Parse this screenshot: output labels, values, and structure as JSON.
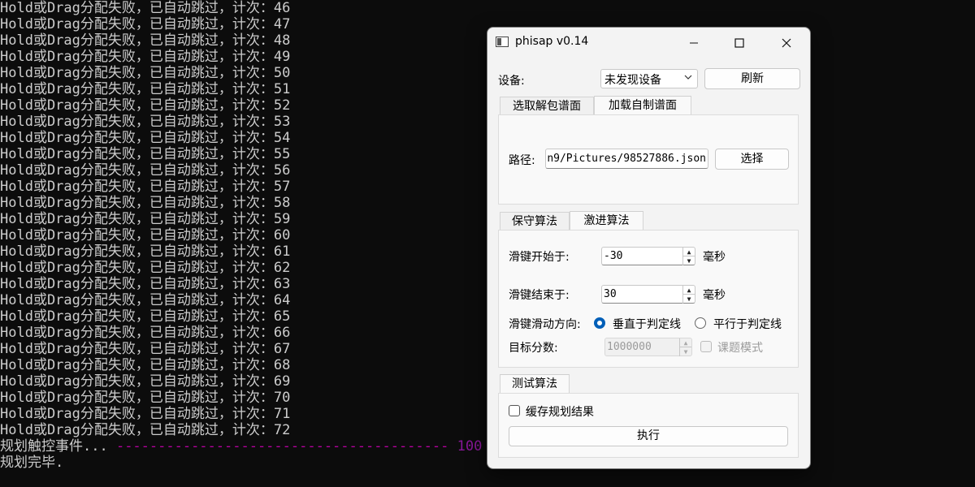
{
  "console": {
    "fail_prefix": "Hold或Drag分配失败，已自动跳过，计次：",
    "fail_counts": [
      46,
      47,
      48,
      49,
      50,
      51,
      52,
      53,
      54,
      55,
      56,
      57,
      58,
      59,
      60,
      61,
      62,
      63,
      64,
      65,
      66,
      67,
      68,
      69,
      70,
      71,
      72
    ],
    "planning_label": "规划触控事件... ",
    "planning_progress_bar": "----------------------------------------",
    "planning_percent": "100",
    "done_label": "规划完毕."
  },
  "window": {
    "title": "phisap v0.14",
    "minimize": "—",
    "maximize": "☐",
    "close": "✕"
  },
  "device": {
    "label": "设备:",
    "selected": "未发现设备",
    "refresh": "刷新"
  },
  "chart_source_tabs": [
    "选取解包谱面",
    "加载自制谱面"
  ],
  "chart_source": {
    "path_label": "路径:",
    "path_value": "n9/Pictures/98527886.json",
    "browse": "选择"
  },
  "algorithm_tabs": [
    "保守算法",
    "激进算法"
  ],
  "algorithm": {
    "slide_start_label": "滑键开始于:",
    "slide_start_value": "-30",
    "slide_start_unit": "毫秒",
    "slide_end_label": "滑键结束于:",
    "slide_end_value": "30",
    "slide_end_unit": "毫秒",
    "direction_label": "滑键滑动方向:",
    "direction_perpendicular": "垂直于判定线",
    "direction_parallel": "平行于判定线",
    "target_score_label": "目标分数:",
    "target_score_value": "1000000",
    "homework_mode": "课题模式"
  },
  "test_tab": "测试算法",
  "test": {
    "cache_label": "缓存规划结果",
    "execute": "执行"
  },
  "colors": {
    "console_bg": "#0c0c0c",
    "console_text": "#cccccc",
    "progress": "#b4009e",
    "accent": "#005fb8"
  }
}
